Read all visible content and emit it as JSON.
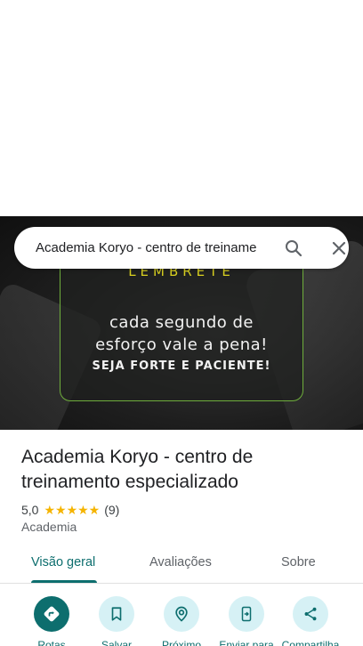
{
  "search": {
    "query": "Academia Koryo - centro de treinamento especializado"
  },
  "hero": {
    "heading": "LEMBRETE",
    "quote_line1": "cada segundo de",
    "quote_line2": "esforço vale a pena!",
    "subline": "SEJA FORTE E PACIENTE!"
  },
  "place": {
    "title_line1": "Academia Koryo - centro de",
    "title_line2": "treinamento especializado",
    "rating": "5,0",
    "stars": "★★★★★",
    "review_count": "(9)",
    "category": "Academia"
  },
  "tabs": [
    {
      "label": "Visão geral",
      "active": true
    },
    {
      "label": "Avaliações",
      "active": false
    },
    {
      "label": "Sobre",
      "active": false
    }
  ],
  "actions": [
    {
      "label": "Rotas",
      "icon": "directions-icon"
    },
    {
      "label": "Salvar",
      "icon": "bookmark-icon"
    },
    {
      "label": "Próximo",
      "icon": "nearby-icon"
    },
    {
      "label": "Enviar para",
      "icon": "send-to-phone-icon"
    },
    {
      "label": "Compartilha",
      "icon": "share-icon"
    }
  ],
  "colors": {
    "accent": "#0d6e6e",
    "action_bg": "#d6f1f5",
    "star": "#f5b400"
  }
}
